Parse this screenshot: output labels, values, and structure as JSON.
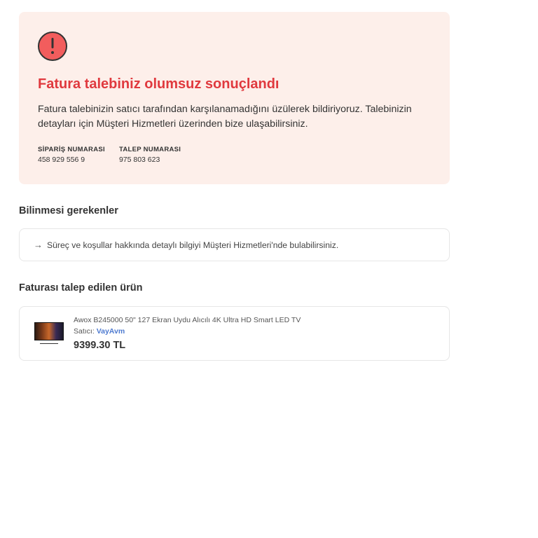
{
  "alert": {
    "icon": "exclamation-circle-icon",
    "icon_color": "#f25d5d",
    "title": "Fatura talebiniz olumsuz sonuçlandı",
    "title_color": "#e0393e",
    "description": "Fatura talebinizin satıcı tarafından karşılanamadığını üzülerek bildiriyoruz. Talebinizin detayları için Müşteri Hizmetleri üzerinden bize ulaşabilirsiniz.",
    "background": "#fdefea",
    "order_number_label": "SİPARİŞ NUMARASI",
    "order_number": "458 929 556 9",
    "request_number_label": "TALEP NUMARASI",
    "request_number": "975 803 623"
  },
  "info_section": {
    "title": "Bilinmesi gerekenler",
    "icon": "arrow-right-icon",
    "text": "Süreç ve koşullar hakkında detaylı bilgiyi Müşteri Hizmetleri'nde bulabilirsiniz."
  },
  "product_section": {
    "title": "Faturası talep edilen ürün",
    "product": {
      "name": "Awox B245000 50\" 127 Ekran Uydu Alıcılı 4K Ultra HD Smart LED TV",
      "seller_label": "Satıcı:",
      "seller_name": "VayAvm",
      "seller_color": "#4f7bd0",
      "price": "9399.30 TL"
    }
  }
}
